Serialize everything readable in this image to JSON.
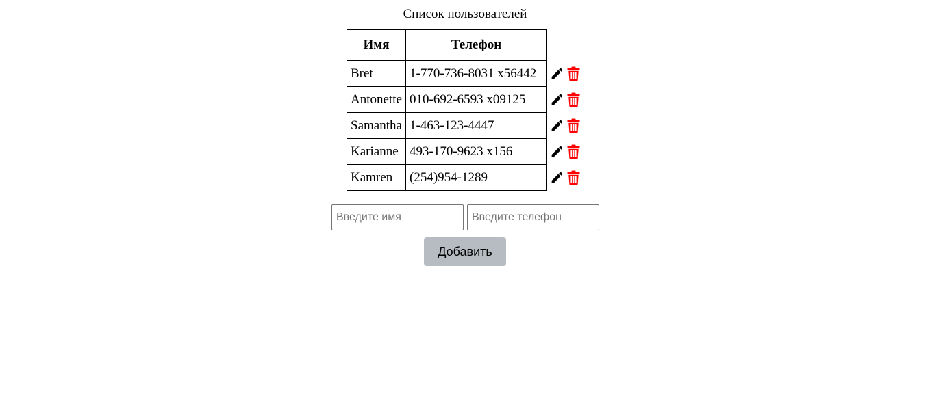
{
  "page": {
    "title": "Список пользователей"
  },
  "table": {
    "headers": {
      "name": "Имя",
      "phone": "Телефон"
    },
    "rows": [
      {
        "name": "Bret",
        "phone": "1-770-736-8031 x56442"
      },
      {
        "name": "Antonette",
        "phone": "010-692-6593 x09125"
      },
      {
        "name": "Samantha",
        "phone": "1-463-123-4447"
      },
      {
        "name": "Karianne",
        "phone": "493-170-9623 x156"
      },
      {
        "name": "Kamren",
        "phone": "(254)954-1289"
      }
    ],
    "row_actions": {
      "edit_icon": "pencil-icon",
      "delete_icon": "trash-icon"
    }
  },
  "form": {
    "name_placeholder": "Введите имя",
    "phone_placeholder": "Введите телефон",
    "name_value": "",
    "phone_value": "",
    "add_label": "Добавить"
  },
  "colors": {
    "edit_icon": "#000000",
    "delete_icon": "#ff0000",
    "add_button_bg": "#b6bcc2"
  }
}
